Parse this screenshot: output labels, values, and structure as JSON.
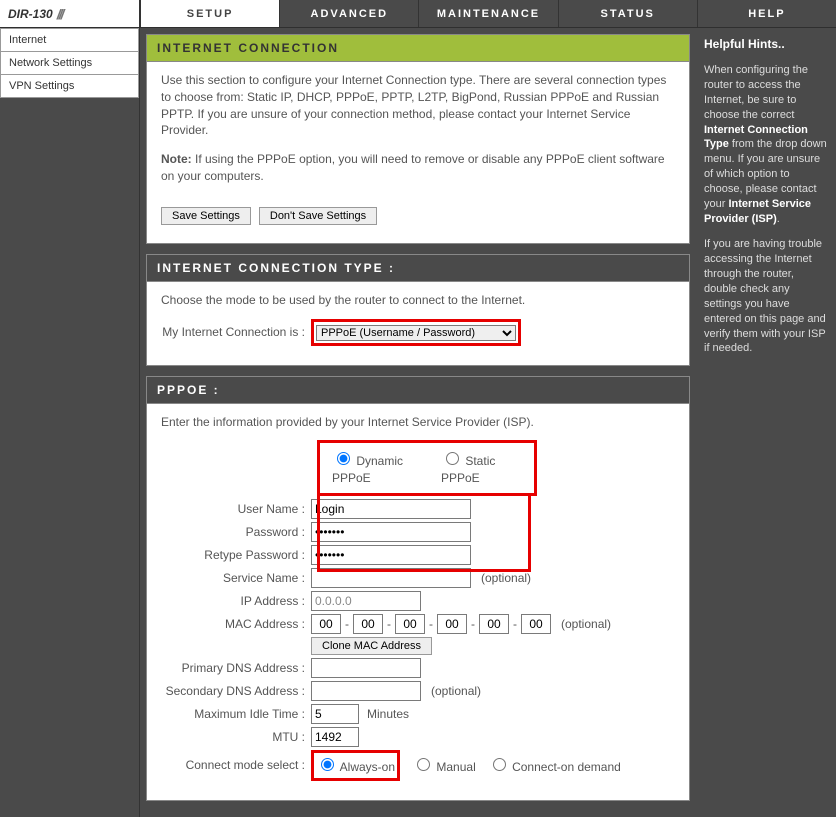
{
  "device_model": "DIR-130",
  "nav": {
    "tabs": [
      "SETUP",
      "ADVANCED",
      "MAINTENANCE",
      "STATUS",
      "HELP"
    ],
    "active": 0
  },
  "sidebar": {
    "items": [
      "Internet",
      "Network Settings",
      "VPN Settings"
    ]
  },
  "intro": {
    "header": "INTERNET CONNECTION",
    "p1": "Use this section to configure your Internet Connection type. There are several connection types to choose from: Static IP, DHCP, PPPoE, PPTP, L2TP, BigPond, Russian PPPoE and Russian PPTP. If you are unsure of your connection method, please contact your Internet Service Provider.",
    "note_label": "Note:",
    "note_text": " If using the PPPoE option, you will need to remove or disable any PPPoE client software on your computers.",
    "save_btn": "Save Settings",
    "dont_save_btn": "Don't Save Settings"
  },
  "conn_type": {
    "header": "INTERNET CONNECTION TYPE :",
    "desc": "Choose the mode to be used by the router to connect to the Internet.",
    "label": "My Internet Connection is :",
    "selected": "PPPoE (Username / Password)"
  },
  "pppoe": {
    "header": "PPPOE :",
    "desc": "Enter the information provided by your Internet Service Provider (ISP).",
    "mode_dynamic": "Dynamic PPPoE",
    "mode_static": "Static PPPoE",
    "labels": {
      "username": "User Name :",
      "password": "Password :",
      "retype": "Retype Password :",
      "service": "Service Name :",
      "ip": "IP Address :",
      "mac": "MAC Address :",
      "clone": "Clone MAC Address",
      "pdns": "Primary DNS Address :",
      "sdns": "Secondary DNS Address :",
      "idle": "Maximum Idle Time :",
      "minutes": "Minutes",
      "mtu": "MTU :",
      "connect_mode": "Connect mode select :",
      "always": "Always-on",
      "manual": "Manual",
      "ondemand": "Connect-on demand",
      "optional": "(optional)"
    },
    "values": {
      "username": "Login",
      "password": "•••••••",
      "retype": "•••••••",
      "service": "",
      "ip": "0.0.0.0",
      "mac": [
        "00",
        "00",
        "00",
        "00",
        "00",
        "00"
      ],
      "pdns": "",
      "sdns": "",
      "idle": "5",
      "mtu": "1492"
    }
  },
  "help": {
    "header": "Helpful Hints..",
    "p1a": "When configuring the router to access the Internet, be sure to choose the correct ",
    "p1b": "Internet Connection Type",
    "p1c": " from the drop down menu. If you are unsure of which option to choose, please contact your ",
    "p1d": "Internet Service Provider (ISP)",
    "p1e": ".",
    "p2": "If you are having trouble accessing the Internet through the router, double check any settings you have entered on this page and verify them with your ISP if needed."
  }
}
